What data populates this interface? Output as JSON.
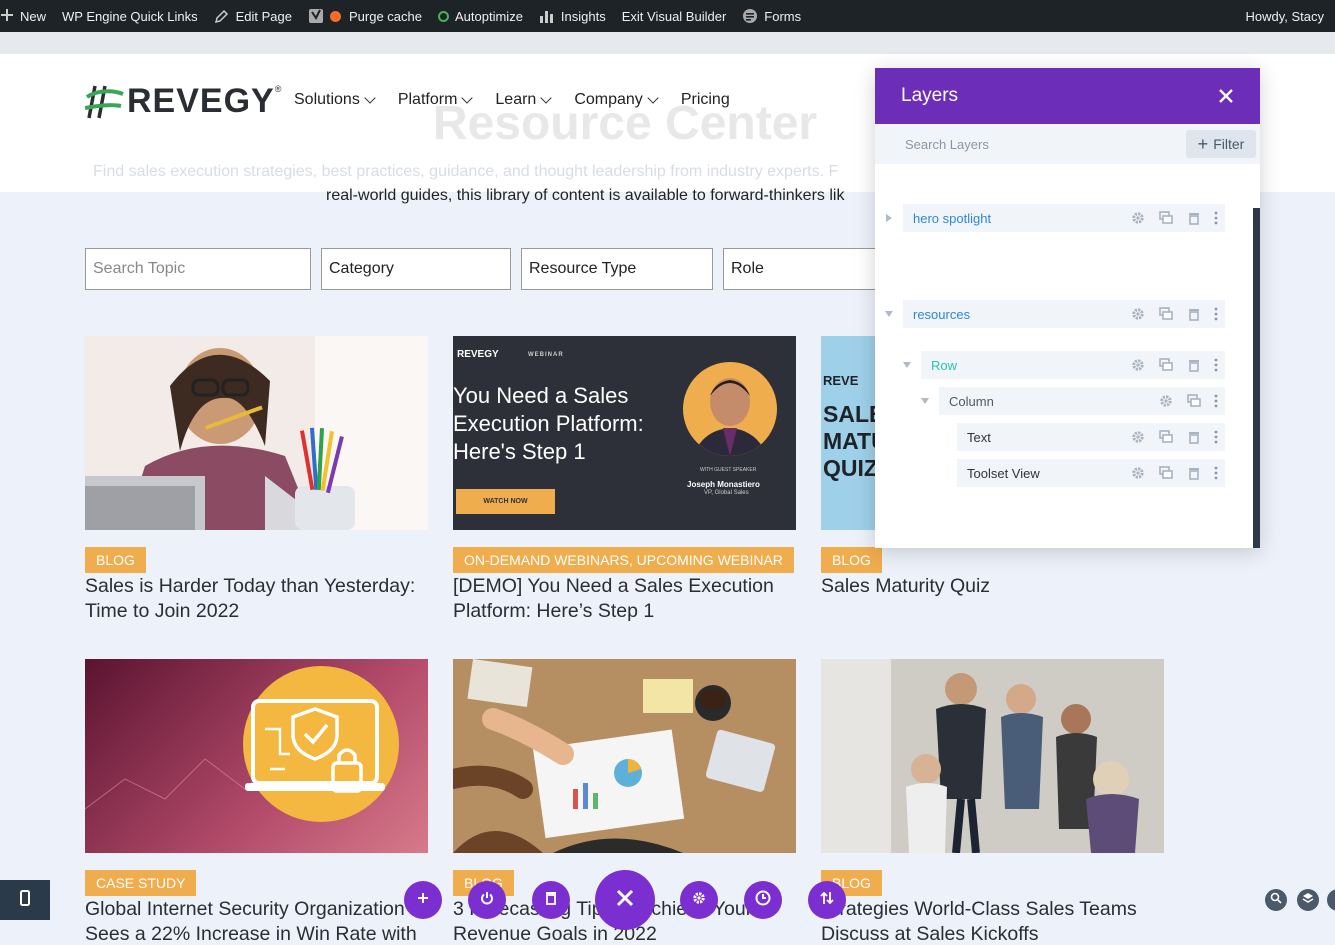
{
  "adminbar": {
    "items": [
      "New",
      "WP Engine Quick Links",
      "Edit Page",
      "",
      "Purge cache",
      "Autoptimize",
      "Insights",
      "Exit Visual Builder",
      "Forms"
    ],
    "howdy": "Howdy, Stacy"
  },
  "header": {
    "logo_text": "REVEGY",
    "logo_reg": "®",
    "nav": [
      "Solutions",
      "Platform",
      "Learn",
      "Company",
      "Pricing"
    ]
  },
  "hero": {
    "title": "Resource Center",
    "subtitle": "Find sales execution strategies, best practices, guidance, and thought leadership from industry experts. F",
    "subtitle2": "real-world guides, this library of content is available to forward-thinkers lik"
  },
  "filters": {
    "search_placeholder": "Search Topic",
    "category": "Category",
    "resource_type": "Resource Type",
    "role": "Role"
  },
  "cards": [
    {
      "tag": "BLOG",
      "title": "Sales is Harder Today than Yesterday: Time to Join 2022"
    },
    {
      "tag": "ON-DEMAND WEBINARS, UPCOMING WEBINAR",
      "title": "[DEMO] You Need a Sales Execution Platform: Here’s Step 1"
    },
    {
      "tag": "BLOG",
      "title": "Sales Maturity Quiz"
    },
    {
      "tag": "CASE STUDY",
      "title": "Global Internet Security Organization Sees a 22% Increase in Win Rate with"
    },
    {
      "tag": "BLOG",
      "title": "3 Forecasting Tips to Achieve Your Revenue Goals in 2022"
    },
    {
      "tag": "BLOG",
      "title": "Strategies World-Class Sales Teams Discuss at Sales Kickoffs"
    }
  ],
  "webinar_card": {
    "brand": "REVEGY",
    "label": "WEBINAR",
    "headline": [
      "You Need a Sales",
      "Execution Platform:",
      "Here's Step 1"
    ],
    "button": "WATCH NOW",
    "guest_label": "WITH GUEST SPEAKER",
    "speaker": "Joseph Monastiero",
    "speaker_role": "VP, Global Sales"
  },
  "quiz_card": {
    "brand": "REVE",
    "lines": [
      "SALE",
      "MATU",
      "QUIZ"
    ]
  },
  "layers": {
    "title": "Layers",
    "search_placeholder": "Search Layers",
    "filter_label": "Filter",
    "rows": [
      {
        "label": "hero spotlight",
        "color": "#2b87da"
      },
      {
        "label": "resources",
        "color": "#2b87da"
      },
      {
        "label": "Row",
        "color": "#29c4a9"
      },
      {
        "label": "Column",
        "color": "#4c5866"
      },
      {
        "label": "Text",
        "color": "#333333"
      },
      {
        "label": "Toolset View",
        "color": "#333333"
      }
    ]
  },
  "colors": {
    "accent_purple": "#6c2eb9",
    "tag_orange": "#f0ad4e",
    "adminbar": "#1d2327"
  }
}
